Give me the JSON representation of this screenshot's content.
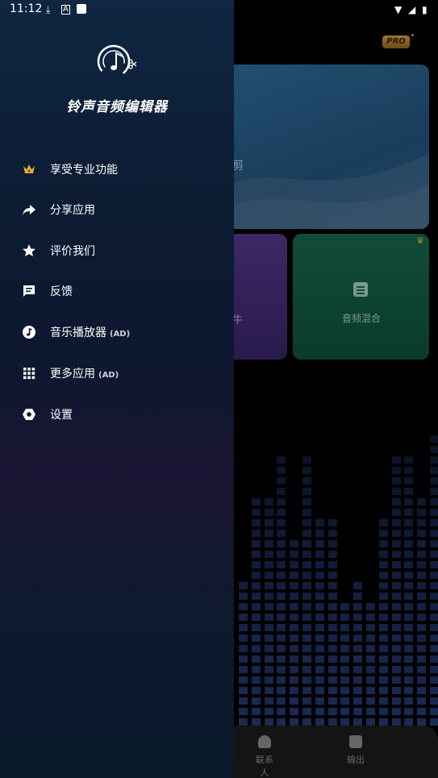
{
  "status_bar": {
    "time": "11:12"
  },
  "drawer": {
    "app_title": "铃声音频编辑器",
    "menu": [
      {
        "label": "享受专业功能",
        "icon": "crown-icon",
        "ad": ""
      },
      {
        "label": "分享应用",
        "icon": "share-icon",
        "ad": ""
      },
      {
        "label": "评价我们",
        "icon": "star-icon",
        "ad": ""
      },
      {
        "label": "反馈",
        "icon": "feedback-icon",
        "ad": ""
      },
      {
        "label": "音乐播放器",
        "icon": "music-icon",
        "ad": "(AD)"
      },
      {
        "label": "更多应用",
        "icon": "grid-icon",
        "ad": "(AD)"
      },
      {
        "label": "设置",
        "icon": "settings-icon",
        "ad": ""
      }
    ]
  },
  "background": {
    "pro_badge": "PRO",
    "card_big_label": "剪",
    "card_purple_label": "牛",
    "card_green_label": "音频混合",
    "bottom_nav": [
      {
        "label": "联系人",
        "icon": "contact-icon"
      },
      {
        "label": "输出",
        "icon": "output-folder-icon"
      }
    ]
  },
  "colors": {
    "accent_gold": "#c99a3a",
    "drawer_top": "#0f2742",
    "eq_cell": "#1a2a55"
  }
}
